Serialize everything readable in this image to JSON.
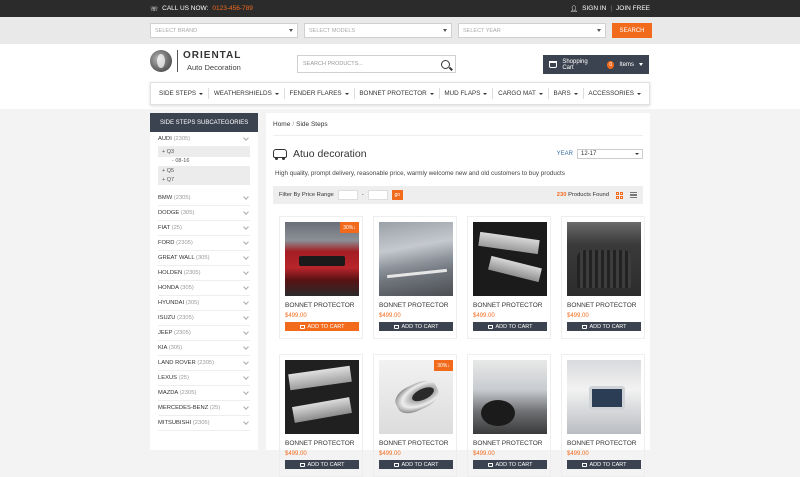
{
  "topbar": {
    "call_label": "CALL US NOW:",
    "phone": "0123-456-789",
    "sign_in": "SIGN IN",
    "sep": "|",
    "join_free": "JOIN FREE"
  },
  "filters": {
    "brand": "SELECT BRAND",
    "models": "SELECT MODELS",
    "year": "SELECT YEAR",
    "search": "SEARCH"
  },
  "header": {
    "brand": "ORIENTAL",
    "sub": "Auto Decoration",
    "search_placeholder": "SEARCH PRODUCTS...",
    "cart_label": "Shopping Cart",
    "cart_count": "0",
    "cart_items": "Items"
  },
  "nav": [
    "SIDE STEPS",
    "WEATHERSHIELDS",
    "FENDER FLARES",
    "BONNET PROTECTOR",
    "MUD FLAPS",
    "CARGO MAT",
    "BARS",
    "ACCESSORIES"
  ],
  "sidebar": {
    "title": "SIDE STEPS SUBCATEGORIES",
    "top": {
      "name": "AUDI",
      "count": "(2305)"
    },
    "subs": [
      {
        "label": "+ Q3",
        "hl": true,
        "deep": false
      },
      {
        "label": "- 08-16",
        "hl": false,
        "deep": true
      },
      {
        "label": "+ Q5",
        "hl": true,
        "deep": false
      },
      {
        "label": "+ Q7",
        "hl": true,
        "deep": false
      }
    ],
    "cats": [
      {
        "name": "BMW",
        "count": "(2305)"
      },
      {
        "name": "DODGE",
        "count": "(305)"
      },
      {
        "name": "FIAT",
        "count": "(25)"
      },
      {
        "name": "FORD",
        "count": "(2305)"
      },
      {
        "name": "GREAT WALL",
        "count": "(305)"
      },
      {
        "name": "HOLDEN",
        "count": "(2305)"
      },
      {
        "name": "HONDA",
        "count": "(305)"
      },
      {
        "name": "HYUNDAI",
        "count": "(305)"
      },
      {
        "name": "ISUZU",
        "count": "(2305)"
      },
      {
        "name": "JEEP",
        "count": "(2305)"
      },
      {
        "name": "KIA",
        "count": "(305)"
      },
      {
        "name": "LAND ROVER",
        "count": "(2305)"
      },
      {
        "name": "LEXUS",
        "count": "(25)"
      },
      {
        "name": "MAZDA",
        "count": "(2305)"
      },
      {
        "name": "MERCEDES-BENZ",
        "count": "(25)"
      },
      {
        "name": "MITSUBISHI",
        "count": "(2305)"
      }
    ]
  },
  "main": {
    "crumb_home": "Home",
    "crumb_sep": "/",
    "crumb_current": "Side Steps",
    "title": "Atuo decoration",
    "year_label": "YEAR",
    "year_value": "12-17",
    "desc": "High quality, prompt delivery, reasonable price, warmly welcome new and old customers to buy products",
    "price_filter": "Filter By Price Range",
    "price_dash": "-",
    "go": "go",
    "found_count": "230",
    "found_label": "Products Found"
  },
  "products": [
    {
      "name": "BONNET PROTECTOR",
      "price": "$499.00",
      "badge": "30%↓",
      "img": "img-red",
      "btn": "ADD TO CART",
      "active": true
    },
    {
      "name": "BONNET PROTECTOR",
      "price": "$499.00",
      "badge": "",
      "img": "img-door",
      "btn": "ADD TO CART",
      "active": false
    },
    {
      "name": "BONNET PROTECTOR",
      "price": "$499.00",
      "badge": "",
      "img": "img-plate",
      "btn": "ADD TO CART",
      "active": false
    },
    {
      "name": "BONNET PROTECTOR",
      "price": "$499.00",
      "badge": "",
      "img": "img-trunk",
      "btn": "ADD TO CART",
      "active": false
    },
    {
      "name": "BONNET PROTECTOR",
      "price": "$499.00",
      "badge": "",
      "img": "img-plate2",
      "btn": "ADD TO CART",
      "active": false
    },
    {
      "name": "BONNET PROTECTOR",
      "price": "$499.00",
      "badge": "30%↓",
      "img": "img-exhaust",
      "btn": "ADD TO CART",
      "active": false
    },
    {
      "name": "BONNET PROTECTOR",
      "price": "$499.00",
      "badge": "",
      "img": "img-jeep",
      "btn": "ADD TO CART",
      "active": false
    },
    {
      "name": "BONNET PROTECTOR",
      "price": "$499.00",
      "badge": "",
      "img": "img-grill",
      "btn": "ADD TO CART",
      "active": false
    }
  ],
  "colors": {
    "accent": "#f26b1d",
    "dark": "#3c4350",
    "topbar": "#2b2b2b"
  }
}
